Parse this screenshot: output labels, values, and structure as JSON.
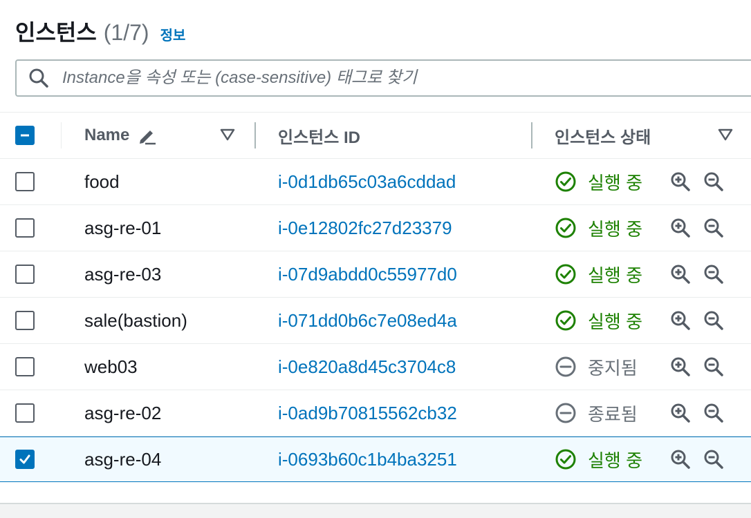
{
  "header": {
    "title": "인스턴스",
    "count": "(1/7)",
    "info_link": "정보"
  },
  "search": {
    "placeholder": "Instance을 속성 또는 (case-sensitive) 태그로 찾기",
    "icon": "search-icon"
  },
  "table": {
    "columns": {
      "name": "Name",
      "instance_id": "인스턴스 ID",
      "state": "인스턴스 상태"
    },
    "rows": [
      {
        "name": "food",
        "instance_id": "i-0d1db65c03a6cddad",
        "state": "실행 중",
        "state_type": "running",
        "selected": false
      },
      {
        "name": "asg-re-01",
        "instance_id": "i-0e12802fc27d23379",
        "state": "실행 중",
        "state_type": "running",
        "selected": false
      },
      {
        "name": "asg-re-03",
        "instance_id": "i-07d9abdd0c55977d0",
        "state": "실행 중",
        "state_type": "running",
        "selected": false
      },
      {
        "name": "sale(bastion)",
        "instance_id": "i-071dd0b6c7e08ed4a",
        "state": "실행 중",
        "state_type": "running",
        "selected": false
      },
      {
        "name": "web03",
        "instance_id": "i-0e820a8d45c3704c8",
        "state": "중지됨",
        "state_type": "stopped",
        "selected": false
      },
      {
        "name": "asg-re-02",
        "instance_id": "i-0ad9b70815562cb32",
        "state": "종료됨",
        "state_type": "terminated",
        "selected": false
      },
      {
        "name": "asg-re-04",
        "instance_id": "i-0693b60c1b4ba3251",
        "state": "실행 중",
        "state_type": "running",
        "selected": true
      }
    ]
  },
  "colors": {
    "link": "#0073bb",
    "running": "#1d8102",
    "stopped": "#687078",
    "selected_bg": "#f1faff"
  }
}
